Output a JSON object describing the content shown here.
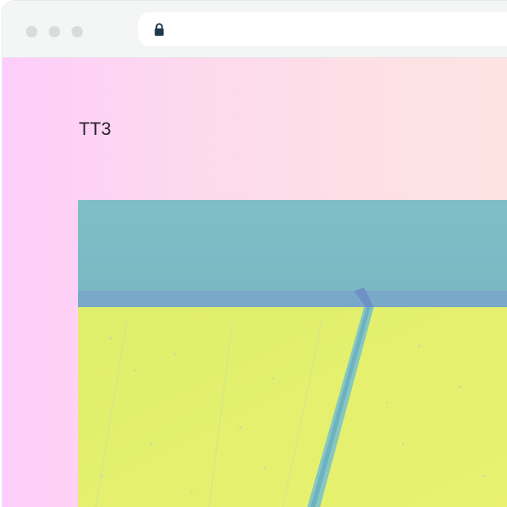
{
  "browser": {
    "window_controls": [
      "close",
      "minimize",
      "maximize"
    ],
    "address_bar": {
      "icon": "lock-icon",
      "url": ""
    }
  },
  "page": {
    "site_title": "TT3",
    "hero_image": {
      "description": "featured-image"
    }
  },
  "colors": {
    "gradient_left": "#fdcdfb",
    "gradient_right": "#fde4e2",
    "text": "#2a2030",
    "image_top": "#7fbcc4",
    "image_bottom": "#e4f06c"
  }
}
